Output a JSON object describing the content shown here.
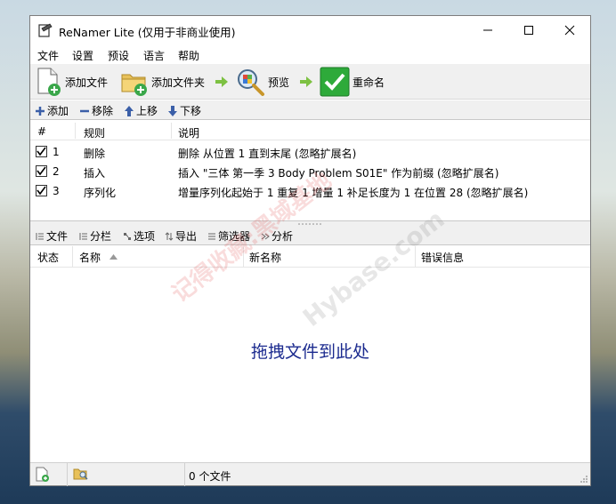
{
  "window": {
    "title": "ReNamer Lite   (仅用于非商业使用)"
  },
  "menu": [
    "文件",
    "设置",
    "预设",
    "语言",
    "帮助"
  ],
  "toolbar": {
    "add_files": "添加文件",
    "add_folder": "添加文件夹",
    "preview": "预览",
    "rename": "重命名"
  },
  "rules_toolbar": {
    "add": "添加",
    "remove": "移除",
    "up": "上移",
    "down": "下移"
  },
  "rules_table": {
    "headers": [
      "#",
      "规则",
      "说明"
    ],
    "rows": [
      {
        "checked": true,
        "num": "1",
        "rule": "删除",
        "desc": "删除 从位置 1 直到末尾 (忽略扩展名)"
      },
      {
        "checked": true,
        "num": "2",
        "rule": "插入",
        "desc": "插入 \"三体 第一季 3 Body Problem S01E\" 作为前缀 (忽略扩展名)"
      },
      {
        "checked": true,
        "num": "3",
        "rule": "序列化",
        "desc": "增量序列化起始于 1 重复 1 增量 1 补足长度为 1 在位置 28 (忽略扩展名)"
      }
    ]
  },
  "files_toolbar": [
    "文件",
    "分栏",
    "选项",
    "导出",
    "筛选器",
    "分析"
  ],
  "files_table": {
    "headers": [
      "状态",
      "名称",
      "新名称",
      "错误信息"
    ],
    "empty_hint": "拖拽文件到此处"
  },
  "status": {
    "file_count": "0 个文件"
  },
  "watermarks": {
    "text1": "记得收藏:黑域基地",
    "text2": "Hybase.com"
  },
  "colors": {
    "accent_blue": "#1c2b8f",
    "toolbar_bg": "#f0f0f0",
    "green_arrow": "#7dc142",
    "rename_green": "#2eaa3a"
  }
}
